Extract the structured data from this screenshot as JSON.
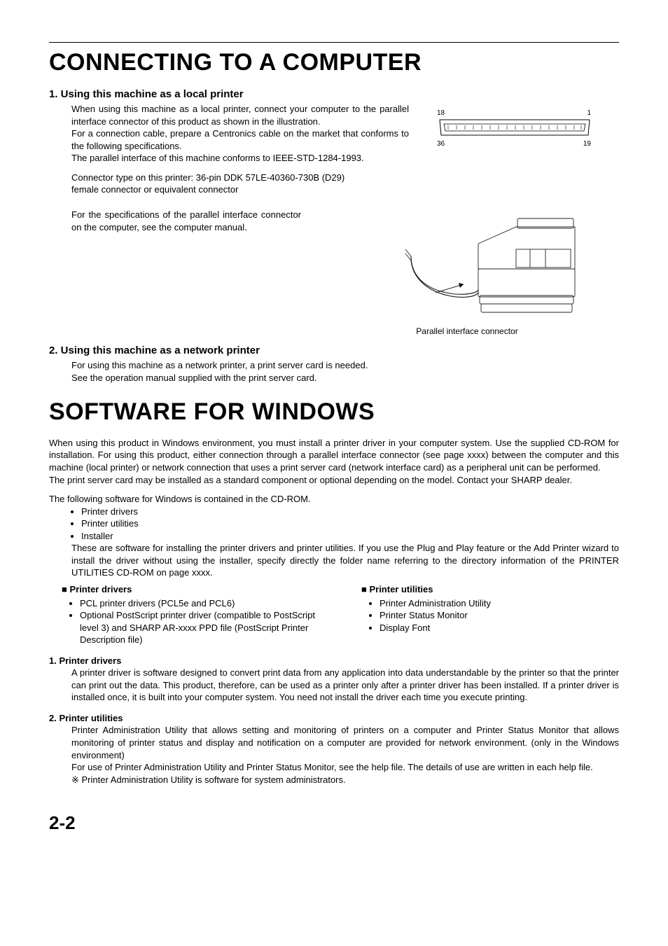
{
  "title1": "CONNECTING TO A COMPUTER",
  "sec1": {
    "heading": "1. Using this machine as a local printer",
    "p1": "When using this machine as a local printer, connect your computer to the parallel interface connector of this product as shown in the illustration.",
    "p2": "For a connection cable, prepare a Centronics cable on the market that conforms to the following specifications.",
    "p3": "The parallel interface of this machine conforms to IEEE-STD-1284-1993.",
    "conn_line1": "Connector type on this printer: 36-pin DDK 57LE-40360-730B (D29)",
    "conn_line2": " female connector or equivalent connector",
    "spec_para": "For the specifications of the parallel interface connector on the computer, see the computer manual.",
    "pin_tl": "18",
    "pin_tr": "1",
    "pin_bl": "36",
    "pin_br": "19",
    "caption": "Parallel interface connector"
  },
  "sec2": {
    "heading": "2. Using this machine as a network printer",
    "p1": "For using this machine as a network printer, a print server card is needed.",
    "p2": "See the operation manual supplied with the print server card."
  },
  "title2": "SOFTWARE FOR WINDOWS",
  "sw": {
    "p1": "When using this product in Windows environment, you must install a printer driver in your computer system. Use the supplied CD-ROM for installation. For using this product, either connection through a parallel interface connector (see page xxxx) between the computer and this machine (local printer) or network connection that uses a print server card (network interface card) as a peripheral unit can be performed.",
    "p2": "The print server card may be installed as a standard component or optional depending on the model. Contact your SHARP dealer.",
    "p3": "The following software for Windows is contained in the CD-ROM.",
    "list": {
      "a": "Printer drivers",
      "b": "Printer utilities",
      "c": "Installer"
    },
    "installer_note": "These are software for installing the printer drivers and printer utilities. If you use the Plug and Play feature or the Add Printer  wizard to install the driver without using the installer, specify directly the folder name referring to the directory information of the PRINTER UTILITIES CD-ROM on page xxxx.",
    "col1_head": "Printer drivers",
    "col1_items": {
      "a": "PCL printer drivers (PCL5e and PCL6)",
      "b": "Optional PostScript printer driver (compatible to PostScript level 3) and SHARP AR-xxxx PPD file (PostScript Printer Description file)"
    },
    "col2_head": "Printer utilities",
    "col2_items": {
      "a": "Printer Administration Utility",
      "b": "Printer Status Monitor",
      "c": "Display Font"
    }
  },
  "sub1": {
    "heading": "1. Printer drivers",
    "p": "A printer driver is software designed to convert print data from any application into data understandable by the printer so that the printer can print out the data. This product, therefore, can be used as a printer only after a printer driver has been installed. If a printer driver is installed once, it is built into your computer system. You need not install the driver each time you execute printing."
  },
  "sub2": {
    "heading": "2. Printer utilities",
    "p1": "Printer Administration Utility that allows setting and monitoring of printers on a computer and Printer Status Monitor that allows monitoring of printer status and display and notification on a computer are provided for network environment. (only in the Windows environment)",
    "p2": "For use of Printer Administration Utility and Printer Status Monitor, see the help file. The details of use are written in each help file.",
    "p3": "※ Printer Administration Utility is software for system administrators."
  },
  "page_num": "2-2"
}
